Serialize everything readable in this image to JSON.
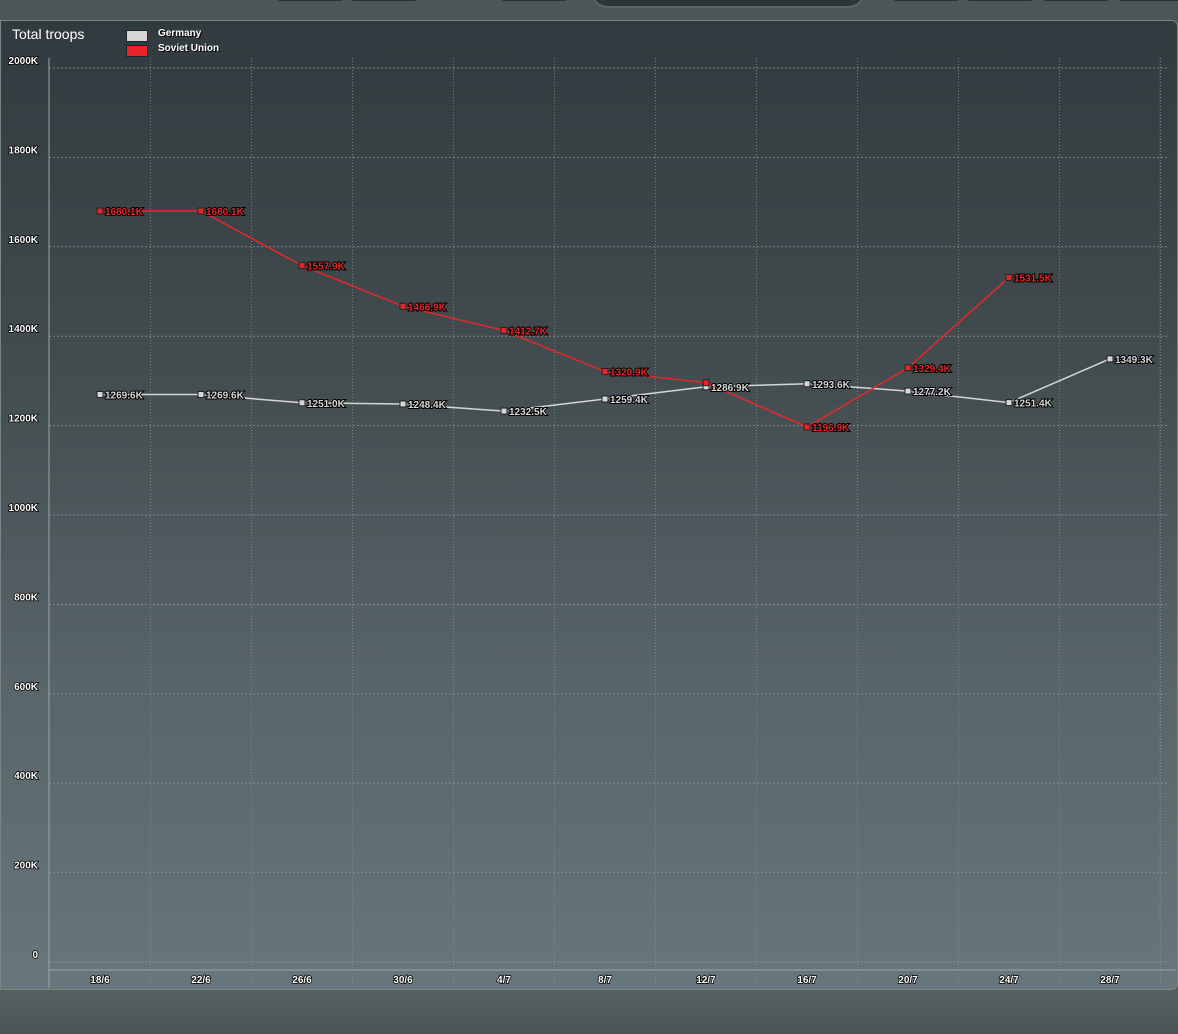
{
  "chart_data": {
    "type": "line",
    "title": "Total troops",
    "xlabel": "",
    "ylabel": "",
    "categories": [
      "18/6",
      "22/6",
      "26/6",
      "30/6",
      "4/7",
      "8/7",
      "12/7",
      "16/7",
      "20/7",
      "24/7",
      "28/7"
    ],
    "ylim": [
      0,
      2000
    ],
    "yticks": [
      "0",
      "200K",
      "400K",
      "600K",
      "800K",
      "1000K",
      "1200K",
      "1400K",
      "1600K",
      "1800K",
      "2000K"
    ],
    "grid": true,
    "legend_position": "top-left",
    "series": [
      {
        "name": "Germany",
        "color": "#d6d6d6",
        "values": [
          1269.6,
          1269.6,
          1251.0,
          1248.4,
          1232.5,
          1259.4,
          1286.9,
          1293.6,
          1277.2,
          1251.4,
          1349.3
        ],
        "labels": [
          "1269.6K",
          "1269.6K",
          "1251.0K",
          "1248.4K",
          "1232.5K",
          "1259.4K",
          "1286.9K",
          "1293.6K",
          "1277.2K",
          "1251.4K",
          "1349.3K"
        ]
      },
      {
        "name": "Soviet Union",
        "color": "#e8262a",
        "values": [
          1680.1,
          1680.1,
          1557.9,
          1466.9,
          1412.7,
          1320.9,
          1296,
          1196.9,
          1329.4,
          1531.5,
          null
        ],
        "labels": [
          "1680.1K",
          "1680.1K",
          "1557.9K",
          "1466.9K",
          "1412.7K",
          "1320.9K",
          null,
          "1196.9K",
          "1329.4K",
          "1531.5K",
          null
        ]
      }
    ]
  }
}
